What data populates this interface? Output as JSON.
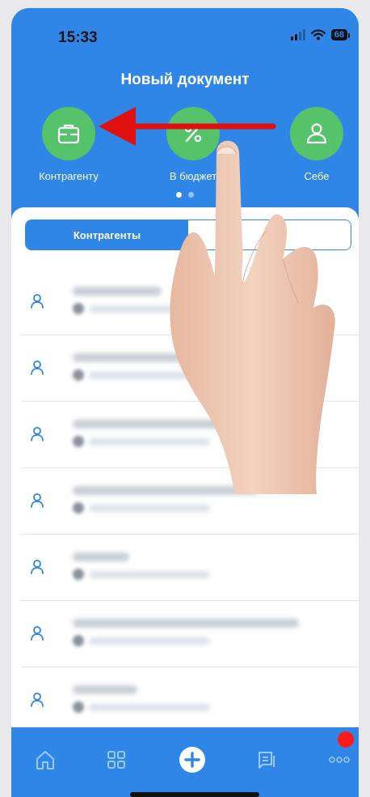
{
  "status": {
    "time": "15:33",
    "battery": "68"
  },
  "header": {
    "title": "Новый документ"
  },
  "actions": [
    {
      "label": "Контрагенту",
      "icon": "briefcase-icon"
    },
    {
      "label": "В бюджет",
      "icon": "percent-icon"
    },
    {
      "label": "Себе",
      "icon": "person-icon"
    }
  ],
  "segment": {
    "active": "Контрагенты",
    "inactive": ""
  },
  "contacts_count": 7,
  "tabbar": [
    "home-icon",
    "grid-icon",
    "plus-icon",
    "documents-icon",
    "more-icon"
  ],
  "colors": {
    "primary": "#2f86e6",
    "accent_green": "#56c26a",
    "arrow": "#e01010"
  }
}
